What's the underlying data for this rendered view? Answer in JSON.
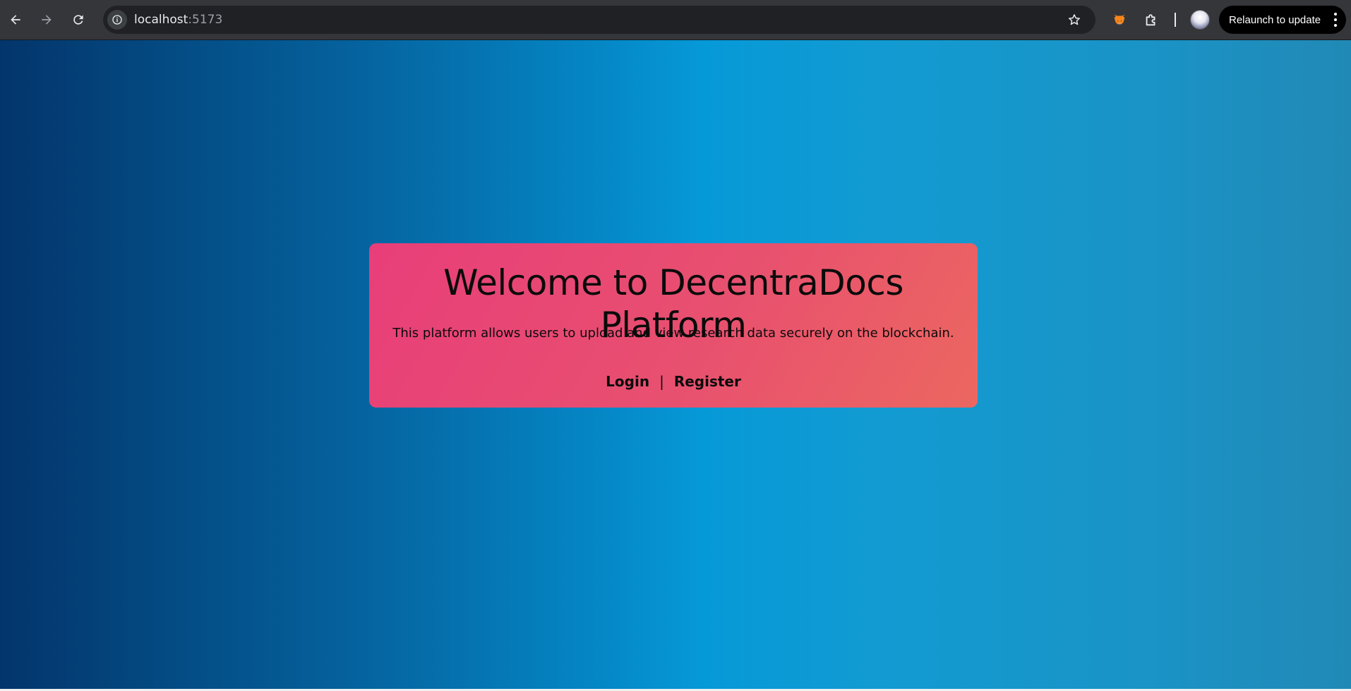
{
  "browser": {
    "url_host": "localhost",
    "url_port": ":5173",
    "relaunch_label": "Relaunch to update"
  },
  "icons": {
    "back": "back-arrow-icon",
    "forward": "forward-arrow-icon",
    "reload": "reload-icon",
    "site_info": "info-icon",
    "bookmark": "star-icon",
    "extension_metamask": "fox-icon",
    "extensions": "puzzle-icon",
    "profile": "avatar",
    "menu": "kebab-menu-icon"
  },
  "colors": {
    "card_gradient_start": "#e83e7a",
    "card_gradient_end": "#ec6760",
    "page_gradient_left": "#03356b",
    "page_gradient_mid": "#0699d8",
    "page_gradient_right": "#2189b6"
  },
  "main": {
    "title": "Welcome to DecentraDocs Platform",
    "description": "This platform allows users to upload and view research data securely on the blockchain.",
    "login_label": "Login",
    "separator": "|",
    "register_label": "Register"
  }
}
